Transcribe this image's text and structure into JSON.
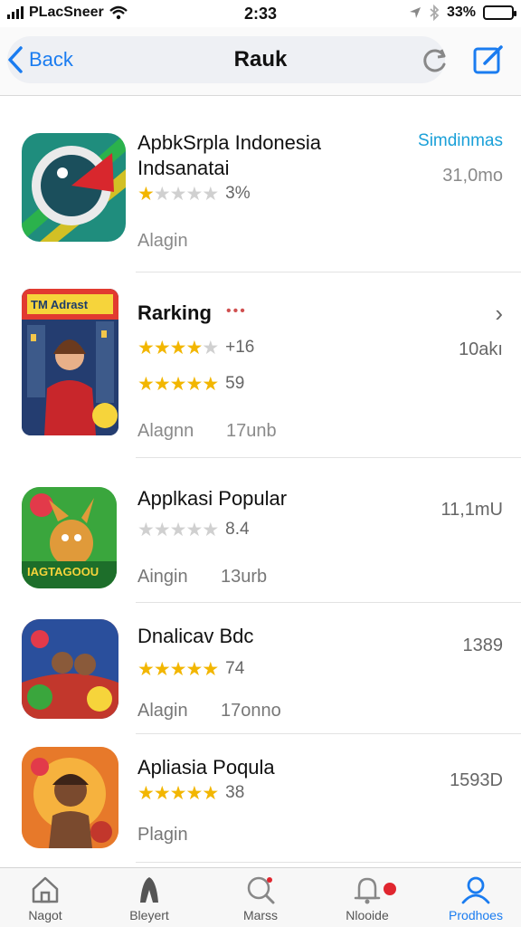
{
  "status_bar": {
    "carrier": "PLacSneer",
    "time": "2:33",
    "battery": "33%",
    "battery_level": 0.33
  },
  "nav": {
    "back_label": "Back",
    "title": "Rauk"
  },
  "apps": [
    {
      "title": "ApbkSrpla Indonesia",
      "subtitle": "Indsanatai",
      "link": "Simdinmas",
      "size": "31,0mo",
      "rating_label": "3%",
      "rating": 1,
      "category": "Alagin",
      "accent": "#1aa0d8"
    },
    {
      "title": "Rarking",
      "dots": "•••",
      "arrow": "›",
      "size": "10akı",
      "rating_label": "+16",
      "rating": 3.5,
      "rating2_label": "59",
      "rating2": 5,
      "category": "Alagnn",
      "extra": "17unb",
      "banner": "TM Adrast"
    },
    {
      "title": "Applkasi Popular",
      "size": "11,1mU",
      "rating_label": "8.4",
      "rating": 0,
      "category": "Aingin",
      "extra": "13urb",
      "banner": "IAGTAGOOU"
    },
    {
      "title": "Dnalicav Bdc",
      "size": "1389",
      "rating_label": "74",
      "rating": 4.5,
      "category": "Alagin",
      "extra": "17onno"
    },
    {
      "title": "Apliasia Poqula",
      "size": "1593D",
      "rating_label": "38",
      "rating": 4.5,
      "category": "Plagin"
    }
  ],
  "tabs": [
    {
      "label": "Nagot",
      "icon": "home-icon"
    },
    {
      "label": "Bleyert",
      "icon": "person-silhouette-icon"
    },
    {
      "label": "Marss",
      "icon": "search-icon"
    },
    {
      "label": "Nlooide",
      "icon": "bell-icon",
      "badge_color": "#e0262f"
    },
    {
      "label": "Prodhoes",
      "icon": "profile-icon",
      "active": true
    }
  ],
  "colors": {
    "accent": "#1a7cf0",
    "star": "#f2b600"
  }
}
